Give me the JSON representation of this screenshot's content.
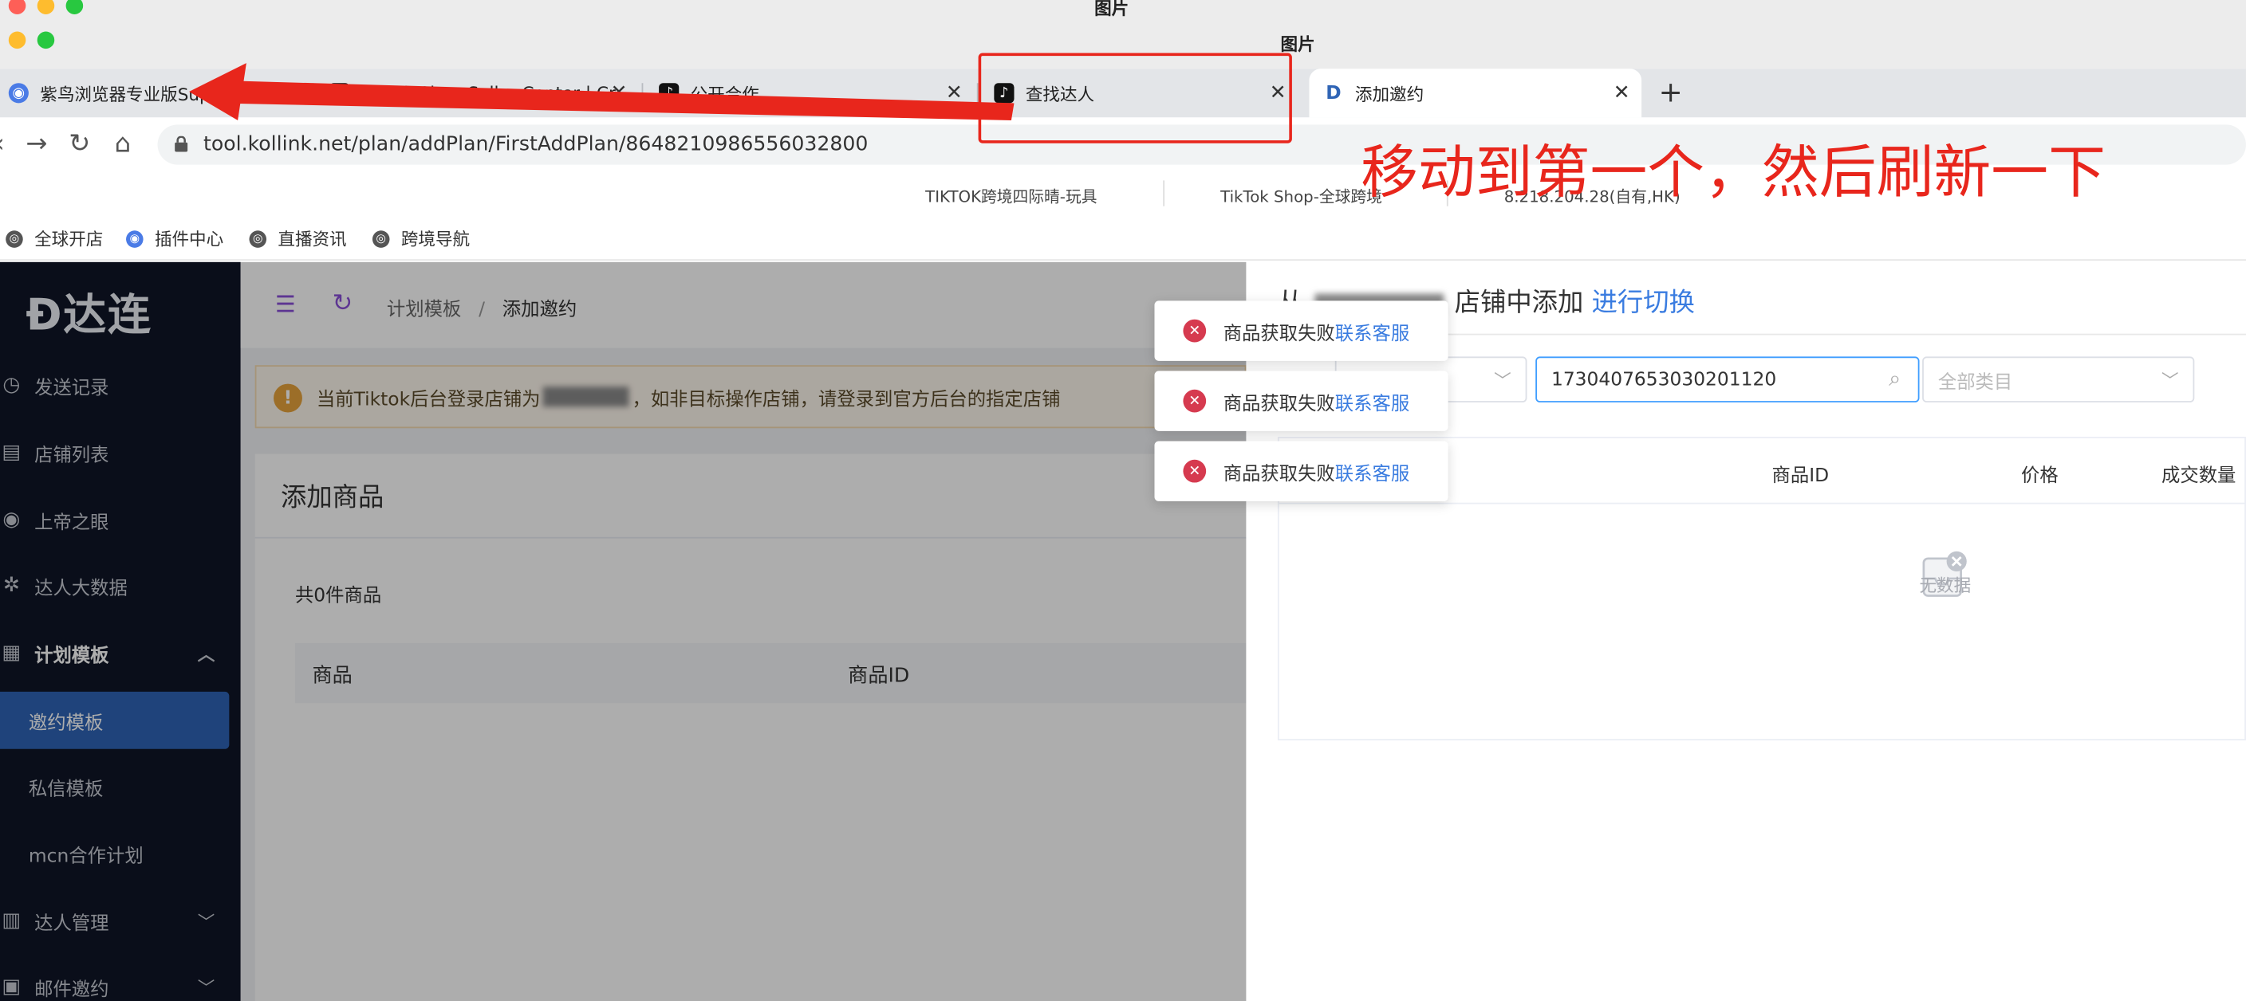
{
  "window": {
    "title": "图片",
    "title_secondary": "图片"
  },
  "tabs": [
    {
      "label": "紫鸟浏览器专业版SuperB",
      "close": "",
      "active": false,
      "icon": "ziniao-browser-icon"
    },
    {
      "label": "TikTok Shop Seller Center | Cr",
      "close": "✕",
      "active": false,
      "icon": "tiktok-icon"
    },
    {
      "label": "公开合作",
      "close": "✕",
      "active": false,
      "icon": "tiktok-icon"
    },
    {
      "label": "查找达人",
      "close": "✕",
      "active": false,
      "icon": "tiktok-icon"
    },
    {
      "label": "添加邀约",
      "close": "✕",
      "active": true,
      "icon": "dalian-icon"
    }
  ],
  "new_tab": "+",
  "address": {
    "url": "tool.kollink.net/plan/addPlan/FirstAddPlan/8648210986556032800"
  },
  "profile_bar": {
    "item1": "TIKTOK跨境四际晴-玩具",
    "item2": "TikTok Shop-全球跨境",
    "item3": "8.218.204.28(自有,HK)"
  },
  "bookmarks": [
    "全球开店",
    "插件中心",
    "直播资讯",
    "跨境导航"
  ],
  "sidebar": {
    "logo": "达连",
    "items": [
      {
        "label": "发送记录",
        "icon": "clock-icon"
      },
      {
        "label": "店铺列表",
        "icon": "store-icon"
      },
      {
        "label": "上帝之眼",
        "icon": "eye-icon"
      },
      {
        "label": "达人大数据",
        "icon": "network-icon"
      },
      {
        "label": "计划模板",
        "icon": "document-icon",
        "expanded": true
      },
      {
        "label": "邀约模板",
        "active": true
      },
      {
        "label": "私信模板"
      },
      {
        "label": "mcn合作计划"
      },
      {
        "label": "达人管理",
        "icon": "grid-icon"
      },
      {
        "label": "邮件邀约",
        "icon": "mail-icon"
      }
    ]
  },
  "breadcrumb": {
    "parent": "计划模板",
    "separator": "/",
    "current": "添加邀约"
  },
  "notice": {
    "prefix": "当前Tiktok后台登录店铺为",
    "suffix": "，如非目标操作店铺，请登录到官方后台的指定店铺"
  },
  "card": {
    "title": "添加商品",
    "count": "共0件商品",
    "col_product": "商品",
    "col_id": "商品ID"
  },
  "drawer": {
    "title_prefix": "从",
    "title_suffix": "店铺中添加",
    "switch_link": "进行切换",
    "search_value": "1730407653030201120",
    "category_placeholder": "全部类目",
    "col_id": "商品ID",
    "col_price": "价格",
    "col_sales": "成交数量",
    "empty_text": "无数据"
  },
  "toasts": [
    {
      "text": "商品获取失败",
      "link": "联系客服"
    },
    {
      "text": "商品获取失败",
      "link": "联系客服"
    },
    {
      "text": "商品获取失败",
      "link": "联系客服"
    }
  ],
  "annotation": {
    "text": "移动到第一个，然后刷新一下",
    "color": "#e8261c"
  }
}
